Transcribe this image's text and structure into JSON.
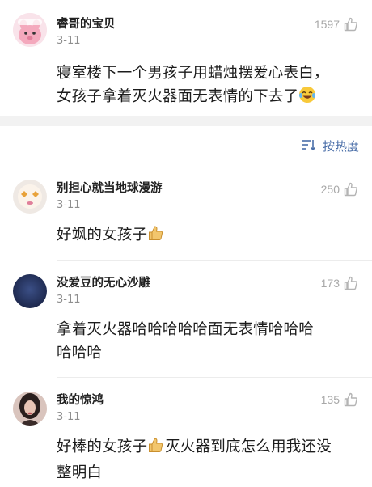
{
  "pinned_comment": {
    "username": "睿哥的宝贝",
    "date": "3-11",
    "likes": "1597",
    "text_line1": "寝室楼下一个男孩子用蜡烛摆爱心表白，",
    "text_line2": "女孩子拿着灭火器面无表情的下去了",
    "emoji_icon": "laughing-crying-emoji-icon"
  },
  "sort": {
    "label": "按热度",
    "icon": "sort-lines-icon"
  },
  "comments": [
    {
      "username": "别担心就当地球漫游",
      "date": "3-11",
      "likes": "250",
      "text": "好飒的女孩子",
      "emoji_icon": "thumbs-up-emoji-icon"
    },
    {
      "username": "没爱豆的无心沙雕",
      "date": "3-11",
      "likes": "173",
      "text_line1": "拿着灭火器哈哈哈哈哈面无表情哈哈哈",
      "text_line2": "哈哈哈"
    },
    {
      "username": "我的惊鸿",
      "date": "3-11",
      "likes": "135",
      "text_part1": "好棒的女孩子",
      "text_part2": "灭火器到底怎么用我还没",
      "text_line2": "整明白",
      "emoji_icon": "thumbs-up-emoji-icon"
    }
  ],
  "colors": {
    "link_blue": "#4a6ea8",
    "muted_gray": "#a8a8a8",
    "band_gray": "#f2f2f2"
  }
}
